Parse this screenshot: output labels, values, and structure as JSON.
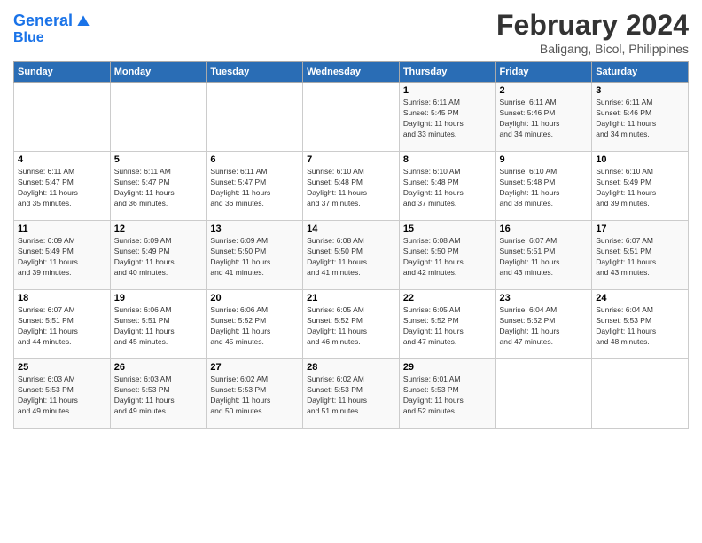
{
  "app": {
    "logo_line1": "General",
    "logo_line2": "Blue"
  },
  "header": {
    "title": "February 2024",
    "subtitle": "Baligang, Bicol, Philippines"
  },
  "days_of_week": [
    "Sunday",
    "Monday",
    "Tuesday",
    "Wednesday",
    "Thursday",
    "Friday",
    "Saturday"
  ],
  "weeks": [
    {
      "days": [
        {
          "num": "",
          "info": ""
        },
        {
          "num": "",
          "info": ""
        },
        {
          "num": "",
          "info": ""
        },
        {
          "num": "",
          "info": ""
        },
        {
          "num": "1",
          "info": "Sunrise: 6:11 AM\nSunset: 5:45 PM\nDaylight: 11 hours\nand 33 minutes."
        },
        {
          "num": "2",
          "info": "Sunrise: 6:11 AM\nSunset: 5:46 PM\nDaylight: 11 hours\nand 34 minutes."
        },
        {
          "num": "3",
          "info": "Sunrise: 6:11 AM\nSunset: 5:46 PM\nDaylight: 11 hours\nand 34 minutes."
        }
      ]
    },
    {
      "days": [
        {
          "num": "4",
          "info": "Sunrise: 6:11 AM\nSunset: 5:47 PM\nDaylight: 11 hours\nand 35 minutes."
        },
        {
          "num": "5",
          "info": "Sunrise: 6:11 AM\nSunset: 5:47 PM\nDaylight: 11 hours\nand 36 minutes."
        },
        {
          "num": "6",
          "info": "Sunrise: 6:11 AM\nSunset: 5:47 PM\nDaylight: 11 hours\nand 36 minutes."
        },
        {
          "num": "7",
          "info": "Sunrise: 6:10 AM\nSunset: 5:48 PM\nDaylight: 11 hours\nand 37 minutes."
        },
        {
          "num": "8",
          "info": "Sunrise: 6:10 AM\nSunset: 5:48 PM\nDaylight: 11 hours\nand 37 minutes."
        },
        {
          "num": "9",
          "info": "Sunrise: 6:10 AM\nSunset: 5:48 PM\nDaylight: 11 hours\nand 38 minutes."
        },
        {
          "num": "10",
          "info": "Sunrise: 6:10 AM\nSunset: 5:49 PM\nDaylight: 11 hours\nand 39 minutes."
        }
      ]
    },
    {
      "days": [
        {
          "num": "11",
          "info": "Sunrise: 6:09 AM\nSunset: 5:49 PM\nDaylight: 11 hours\nand 39 minutes."
        },
        {
          "num": "12",
          "info": "Sunrise: 6:09 AM\nSunset: 5:49 PM\nDaylight: 11 hours\nand 40 minutes."
        },
        {
          "num": "13",
          "info": "Sunrise: 6:09 AM\nSunset: 5:50 PM\nDaylight: 11 hours\nand 41 minutes."
        },
        {
          "num": "14",
          "info": "Sunrise: 6:08 AM\nSunset: 5:50 PM\nDaylight: 11 hours\nand 41 minutes."
        },
        {
          "num": "15",
          "info": "Sunrise: 6:08 AM\nSunset: 5:50 PM\nDaylight: 11 hours\nand 42 minutes."
        },
        {
          "num": "16",
          "info": "Sunrise: 6:07 AM\nSunset: 5:51 PM\nDaylight: 11 hours\nand 43 minutes."
        },
        {
          "num": "17",
          "info": "Sunrise: 6:07 AM\nSunset: 5:51 PM\nDaylight: 11 hours\nand 43 minutes."
        }
      ]
    },
    {
      "days": [
        {
          "num": "18",
          "info": "Sunrise: 6:07 AM\nSunset: 5:51 PM\nDaylight: 11 hours\nand 44 minutes."
        },
        {
          "num": "19",
          "info": "Sunrise: 6:06 AM\nSunset: 5:51 PM\nDaylight: 11 hours\nand 45 minutes."
        },
        {
          "num": "20",
          "info": "Sunrise: 6:06 AM\nSunset: 5:52 PM\nDaylight: 11 hours\nand 45 minutes."
        },
        {
          "num": "21",
          "info": "Sunrise: 6:05 AM\nSunset: 5:52 PM\nDaylight: 11 hours\nand 46 minutes."
        },
        {
          "num": "22",
          "info": "Sunrise: 6:05 AM\nSunset: 5:52 PM\nDaylight: 11 hours\nand 47 minutes."
        },
        {
          "num": "23",
          "info": "Sunrise: 6:04 AM\nSunset: 5:52 PM\nDaylight: 11 hours\nand 47 minutes."
        },
        {
          "num": "24",
          "info": "Sunrise: 6:04 AM\nSunset: 5:53 PM\nDaylight: 11 hours\nand 48 minutes."
        }
      ]
    },
    {
      "days": [
        {
          "num": "25",
          "info": "Sunrise: 6:03 AM\nSunset: 5:53 PM\nDaylight: 11 hours\nand 49 minutes."
        },
        {
          "num": "26",
          "info": "Sunrise: 6:03 AM\nSunset: 5:53 PM\nDaylight: 11 hours\nand 49 minutes."
        },
        {
          "num": "27",
          "info": "Sunrise: 6:02 AM\nSunset: 5:53 PM\nDaylight: 11 hours\nand 50 minutes."
        },
        {
          "num": "28",
          "info": "Sunrise: 6:02 AM\nSunset: 5:53 PM\nDaylight: 11 hours\nand 51 minutes."
        },
        {
          "num": "29",
          "info": "Sunrise: 6:01 AM\nSunset: 5:53 PM\nDaylight: 11 hours\nand 52 minutes."
        },
        {
          "num": "",
          "info": ""
        },
        {
          "num": "",
          "info": ""
        }
      ]
    }
  ]
}
